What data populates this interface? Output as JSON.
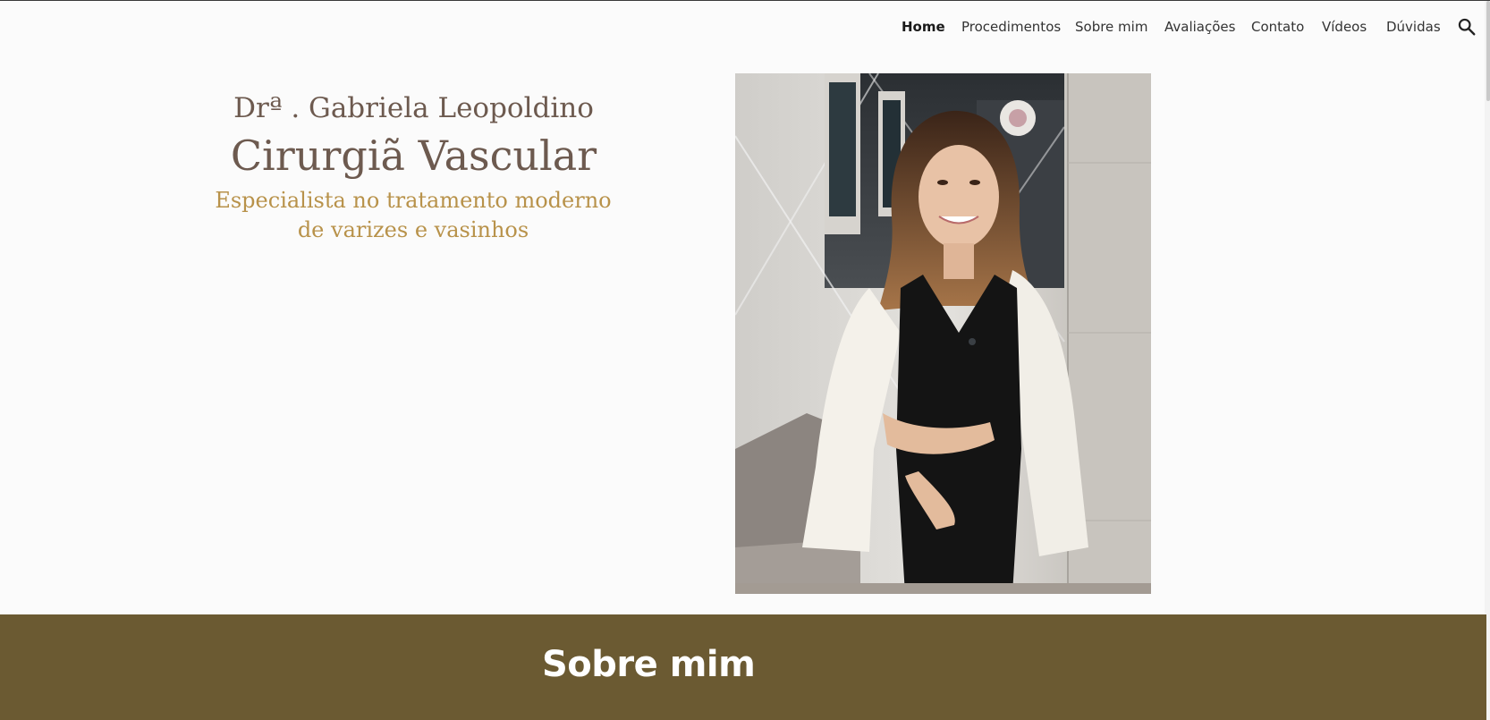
{
  "nav": {
    "items": [
      {
        "label": "Home",
        "active": true
      },
      {
        "label": "Procedimentos",
        "active": false
      },
      {
        "label": "Sobre mim",
        "active": false
      },
      {
        "label": "Avaliações",
        "active": false
      },
      {
        "label": "Contato",
        "active": false
      },
      {
        "label": "Vídeos",
        "active": false
      },
      {
        "label": "Dúvidas",
        "active": false
      }
    ],
    "search_icon": "search-icon"
  },
  "hero": {
    "name": "Drª . Gabriela Leopoldino",
    "specialty": "Cirurgiã Vascular",
    "tagline_line1": "Especialista no tratamento moderno",
    "tagline_line2": "de varizes e vasinhos",
    "photo": "portrait-photo"
  },
  "about": {
    "title": "Sobre mim"
  },
  "colors": {
    "brand_brown": "#6b5a32",
    "name_text": "#6d5a4f",
    "tagline_gold": "#b8924a",
    "background": "#fbfbfb"
  }
}
